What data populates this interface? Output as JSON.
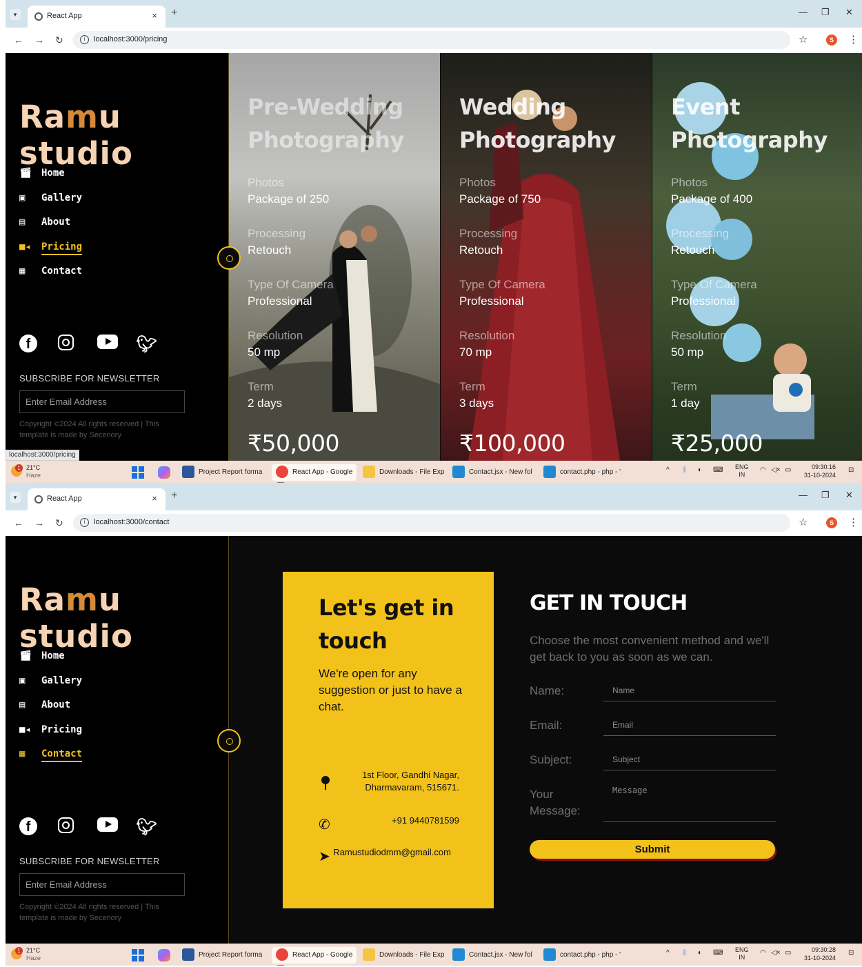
{
  "shot1": {
    "browser": {
      "tab_title": "React App",
      "url": "localhost:3000/pricing",
      "profile_initial": "S",
      "status_url": "localhost:3000/pricing"
    },
    "sidebar": {
      "logo": [
        "Ra",
        "m",
        "u studio"
      ],
      "nav": [
        {
          "label": "Home",
          "icon": "clapperboard-icon",
          "active": false
        },
        {
          "label": "Gallery",
          "icon": "image-icon",
          "active": false
        },
        {
          "label": "About",
          "icon": "film-icon",
          "active": false
        },
        {
          "label": "Pricing",
          "icon": "video-camera-icon",
          "active": true
        },
        {
          "label": "Contact",
          "icon": "contact-card-icon",
          "active": false
        }
      ],
      "newsletter_title": "SUBSCRIBE FOR NEWSLETTER",
      "email_placeholder": "Enter Email Address",
      "copyright": "Copyright ©2024 All rights reserved | This template is made by Secenory"
    },
    "cards": [
      {
        "title_line1": "Pre-Wedding",
        "title_line2": "Photography",
        "photos_label": "Photos",
        "photos_value": "Package of 250",
        "processing_label": "Processing",
        "processing_value": "Retouch",
        "camera_label": "Type Of Camera",
        "camera_value": "Professional",
        "resolution_label": "Resolution",
        "resolution_value": "50 mp",
        "term_label": "Term",
        "term_value": "2 days",
        "price": "₹50,000"
      },
      {
        "title_line1": "Wedding",
        "title_line2": "Photography",
        "photos_label": "Photos",
        "photos_value": "Package of 750",
        "processing_label": "Processing",
        "processing_value": "Retouch",
        "camera_label": "Type Of Camera",
        "camera_value": "Professional",
        "resolution_label": "Resolution",
        "resolution_value": "70 mp",
        "term_label": "Term",
        "term_value": "3 days",
        "price": "₹100,000"
      },
      {
        "title_line1": "Event",
        "title_line2": "Photography",
        "photos_label": "Photos",
        "photos_value": "Package of 400",
        "processing_label": "Processing",
        "processing_value": "Retouch",
        "camera_label": "Type Of Camera",
        "camera_value": "Professional",
        "resolution_label": "Resolution",
        "resolution_value": "50 mp",
        "term_label": "Term",
        "term_value": "1 day",
        "price": "₹25,000"
      }
    ]
  },
  "shot2": {
    "browser": {
      "tab_title": "React App",
      "url": "localhost:3000/contact",
      "profile_initial": "S"
    },
    "sidebar": {
      "logo": [
        "Ra",
        "m",
        "u studio"
      ],
      "nav": [
        {
          "label": "Home",
          "icon": "clapperboard-icon",
          "active": false
        },
        {
          "label": "Gallery",
          "icon": "image-icon",
          "active": false
        },
        {
          "label": "About",
          "icon": "film-icon",
          "active": false
        },
        {
          "label": "Pricing",
          "icon": "video-camera-icon",
          "active": false
        },
        {
          "label": "Contact",
          "icon": "contact-card-icon",
          "active": true
        }
      ],
      "newsletter_title": "SUBSCRIBE FOR NEWSLETTER",
      "email_placeholder": "Enter Email Address",
      "copyright": "Copyright ©2024 All rights reserved | This template is made by Secenory"
    },
    "contact_card": {
      "title": "Let's get in touch",
      "subtitle": "We're open for any suggestion or just to have a chat.",
      "address_line1": "1st Floor, Gandhi Nagar,",
      "address_line2": "Dharmavaram, 515671.",
      "phone": "+91 9440781599",
      "email": "Ramustudiodmm@gmail.com"
    },
    "form": {
      "heading": "GET IN TOUCH",
      "description": "Choose the most convenient method and we'll get back to you as soon as we can.",
      "name_label": "Name:",
      "name_placeholder": "Name",
      "email_label": "Email:",
      "email_placeholder": "Email",
      "subject_label": "Subject:",
      "subject_placeholder": "Subject",
      "message_label_line1": "Your",
      "message_label_line2": "Message:",
      "message_placeholder": "Message",
      "submit_label": "Submit"
    }
  },
  "taskbar": {
    "temperature": "21°C",
    "weather": "Haze",
    "weather_badge": "1",
    "apps": [
      {
        "label": "Project Report forma",
        "color": "#2b579a"
      },
      {
        "label": "React App - Google",
        "color": "#e8453c"
      },
      {
        "label": "Downloads - File Exp",
        "color": "#f5c542"
      },
      {
        "label": "Contact.jsx - New fol",
        "color": "#1f8ad2"
      },
      {
        "label": "contact.php - php - '",
        "color": "#1f8ad2"
      }
    ],
    "lang_line1": "ENG",
    "lang_line2": "IN",
    "shot1_time": "09:30:16",
    "shot2_time": "09:30:28",
    "date": "31-10-2024"
  },
  "colors": {
    "accent": "#f2c21b",
    "background": "#0b0b0b",
    "sidebar": "#000000"
  }
}
